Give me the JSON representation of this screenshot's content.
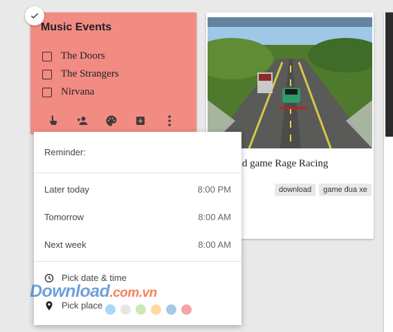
{
  "music_note": {
    "title": "Music Events",
    "items": [
      "The Doors",
      "The Strangers",
      "Nirvana"
    ],
    "color": "#f28b82",
    "toolbar_icons": [
      "reminder-icon",
      "collaborator-icon",
      "palette-icon",
      "archive-icon",
      "more-icon"
    ]
  },
  "game_note": {
    "title": "nload game Rage Racing",
    "labels": [
      "download",
      "game đua xe"
    ]
  },
  "reminder_popup": {
    "header": "Reminder:",
    "options": [
      {
        "label": "Later today",
        "time": "8:00 PM"
      },
      {
        "label": "Tomorrow",
        "time": "8:00 AM"
      },
      {
        "label": "Next week",
        "time": "8:00 AM"
      }
    ],
    "pick_date": "Pick date & time",
    "pick_place": "Pick place"
  },
  "swatch_colors": [
    "#a7d8f5",
    "#e6e6e6",
    "#cce8b5",
    "#fdd9a0",
    "#a8c9e4",
    "#f5a3a3"
  ],
  "watermark": {
    "main": "Download",
    "suffix": ".com.vn"
  }
}
